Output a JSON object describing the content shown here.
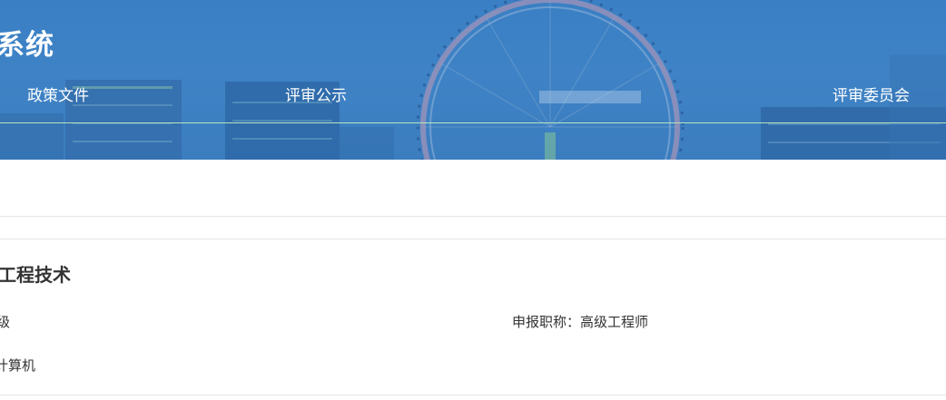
{
  "header": {
    "site_title": "系统",
    "nav": [
      {
        "label": "政策文件"
      },
      {
        "label": "评审公示"
      },
      {
        "label": "评审委员会"
      }
    ]
  },
  "section": {
    "title": "工程技术",
    "fields": [
      {
        "text": "级"
      },
      {
        "text": "申报职称：高级工程师"
      },
      {
        "text": "计算机"
      }
    ]
  },
  "colors": {
    "banner_blue": "#3f83c6",
    "nav_underline": "#b7e5c0",
    "text_dark": "#333333",
    "divider": "#e5e5e5"
  }
}
